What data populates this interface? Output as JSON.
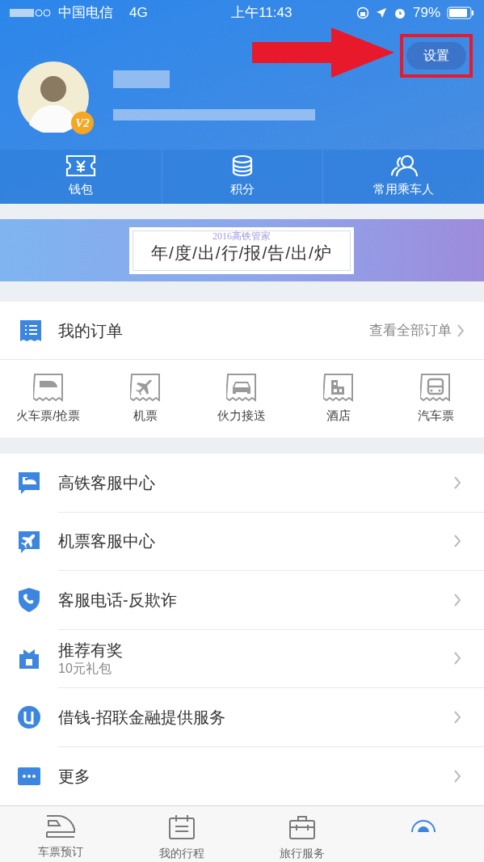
{
  "status_bar": {
    "carrier": "中国电信",
    "network": "4G",
    "time": "上午11:43",
    "battery": "79%"
  },
  "profile": {
    "level_badge": "V2",
    "settings_button": "设置",
    "annotation": {
      "highlighted": true
    }
  },
  "shortcuts": [
    {
      "kind": "wallet",
      "label": "钱包"
    },
    {
      "kind": "points",
      "label": "积分"
    },
    {
      "kind": "passengers",
      "label": "常用乘车人"
    }
  ],
  "banner": {
    "subtitle": "2016高铁管家",
    "title": "年/度/出/行/报/告/出/炉"
  },
  "orders": {
    "title": "我的订单",
    "link": "查看全部订单",
    "items": [
      {
        "kind": "train",
        "label": "火车票/抢票"
      },
      {
        "kind": "plane",
        "label": "机票"
      },
      {
        "kind": "car",
        "label": "伙力接送"
      },
      {
        "kind": "hotel",
        "label": "酒店"
      },
      {
        "kind": "bus",
        "label": "汽车票"
      }
    ]
  },
  "menu": [
    {
      "kind": "train",
      "label": "高铁客服中心"
    },
    {
      "kind": "plane",
      "label": "机票客服中心"
    },
    {
      "kind": "shield",
      "label": "客服电话-反欺诈"
    },
    {
      "kind": "gift",
      "label": "推荐有奖",
      "sublabel": "10元礼包"
    },
    {
      "kind": "loan",
      "label": "借钱-招联金融提供服务"
    },
    {
      "kind": "more",
      "label": "更多"
    }
  ],
  "tab_bar": [
    {
      "kind": "train",
      "label": "车票预订",
      "selected": false
    },
    {
      "kind": "schedule",
      "label": "我的行程",
      "selected": false
    },
    {
      "kind": "suitcase",
      "label": "旅行服务",
      "selected": false
    },
    {
      "kind": "profile",
      "selected": true
    }
  ]
}
